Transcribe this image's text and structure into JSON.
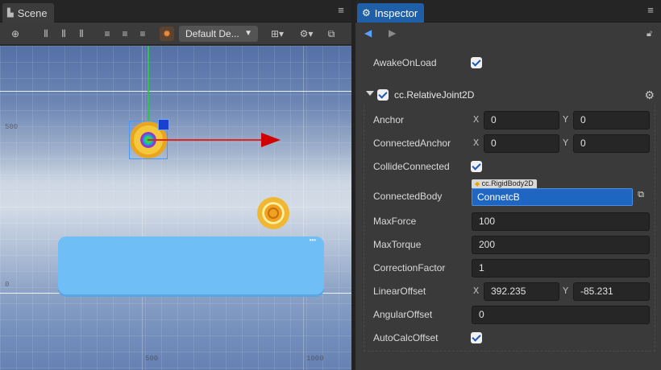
{
  "scene": {
    "tab_title": "Scene",
    "design_resolution": "Default De...",
    "axis_labels": {
      "y_500": "500",
      "y_0": "0",
      "x_500": "500",
      "x_1000": "1000"
    }
  },
  "inspector": {
    "tab_title": "Inspector",
    "awake_on_load": {
      "label": "AwakeOnLoad",
      "checked": true
    },
    "component": {
      "title": "cc.RelativeJoint2D",
      "enabled": true,
      "properties": {
        "anchor": {
          "label": "Anchor",
          "x_tag": "X",
          "x": "0",
          "y_tag": "Y",
          "y": "0"
        },
        "connected_anchor": {
          "label": "ConnectedAnchor",
          "x_tag": "X",
          "x": "0",
          "y_tag": "Y",
          "y": "0"
        },
        "collide_connected": {
          "label": "CollideConnected",
          "checked": true
        },
        "connected_body": {
          "label": "ConnectedBody",
          "type_hint": "cc.RigidBody2D",
          "value": "ConnetcB"
        },
        "max_force": {
          "label": "MaxForce",
          "value": "100"
        },
        "max_torque": {
          "label": "MaxTorque",
          "value": "200"
        },
        "correction_factor": {
          "label": "CorrectionFactor",
          "value": "1"
        },
        "linear_offset": {
          "label": "LinearOffset",
          "x_tag": "X",
          "x": "392.235",
          "y_tag": "Y",
          "y": "-85.231"
        },
        "angular_offset": {
          "label": "AngularOffset",
          "value": "0"
        },
        "auto_calc_offset": {
          "label": "AutoCalcOffset",
          "checked": true
        }
      }
    }
  },
  "colors": {
    "accent": "#1e5fa8",
    "selected_field": "#1f66c3",
    "x_axis": "#e02424",
    "y_axis": "#2ec54a"
  }
}
